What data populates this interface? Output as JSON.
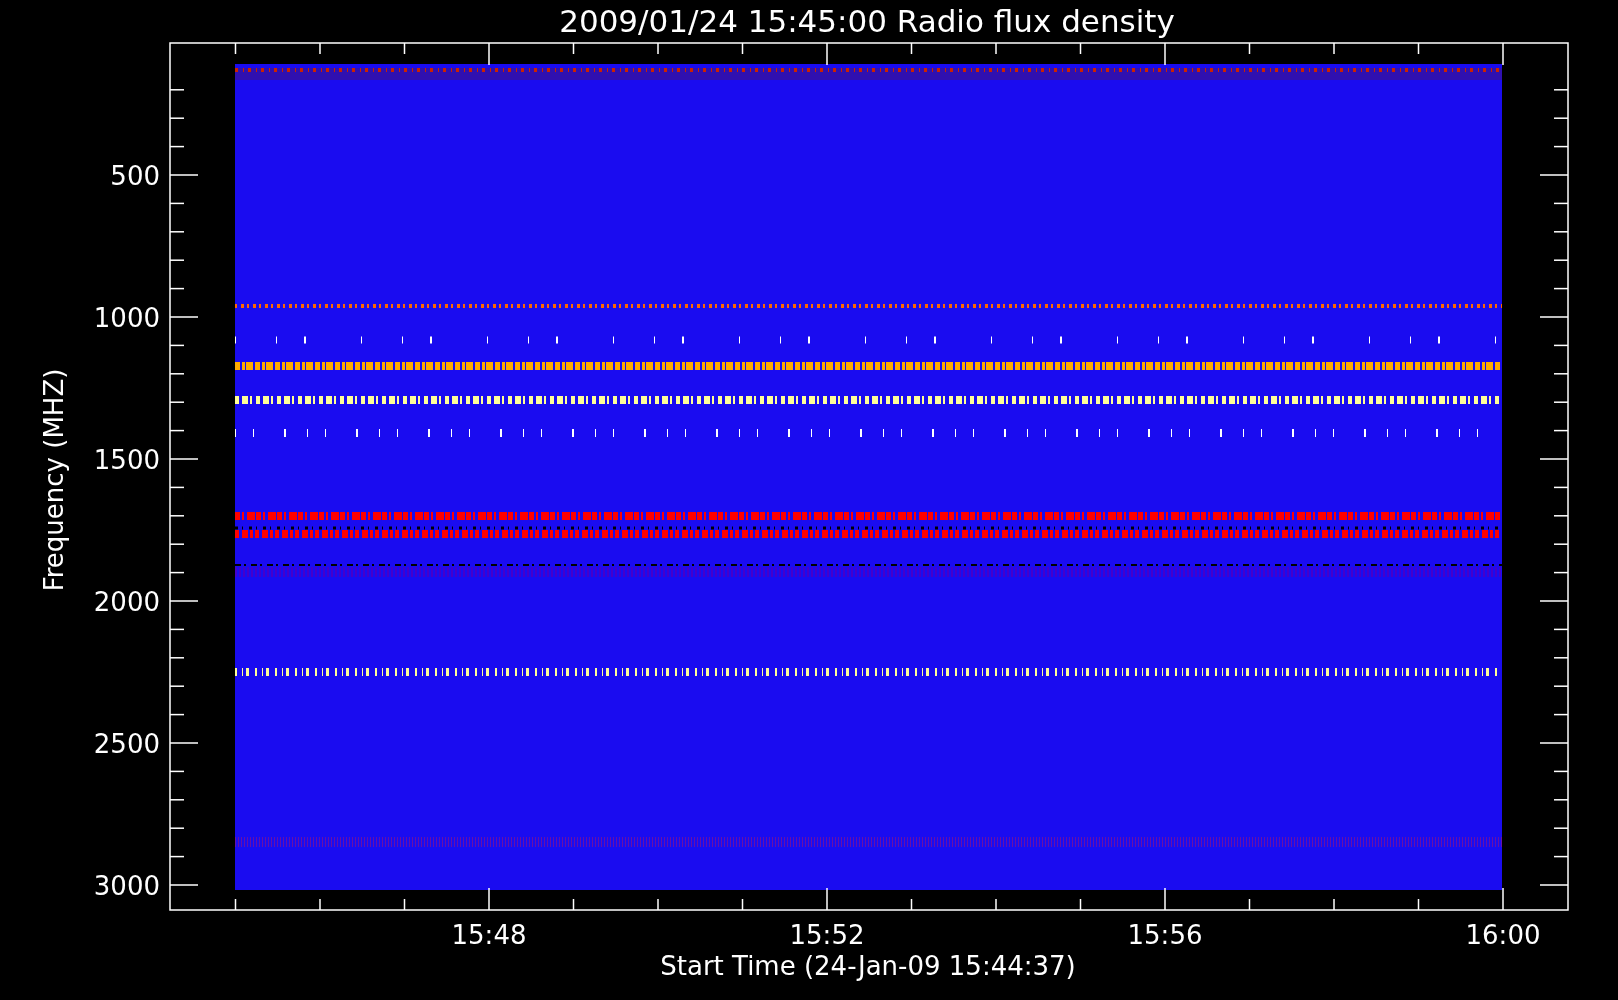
{
  "title": "2009/01/24 15:45:00 Radio flux density",
  "x_axis": {
    "label": "Start Time (24-Jan-09 15:44:37)",
    "ticks": [
      "15:48",
      "15:52",
      "15:56",
      "16:00"
    ]
  },
  "y_axis": {
    "label": "Frequency (MHZ)",
    "ticks": [
      "500",
      "1000",
      "1500",
      "2000",
      "2500",
      "3000"
    ]
  }
}
